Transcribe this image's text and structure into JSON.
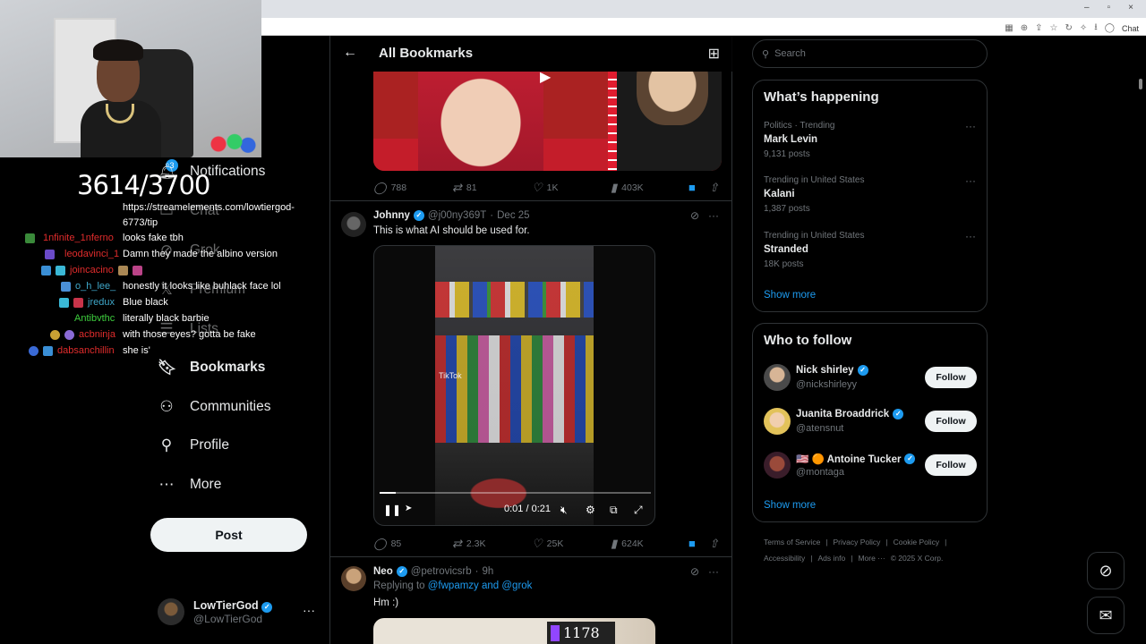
{
  "browser": {
    "minimize": "–",
    "restore": "▫",
    "close": "×",
    "chat_label": "Chat"
  },
  "nav": {
    "notifications": {
      "label": "Notifications",
      "badge": "3"
    },
    "chat": "Chat",
    "grok": "Grok",
    "premium": "Premium",
    "lists": "Lists",
    "bookmarks": "Bookmarks",
    "communities": "Communities",
    "profile": "Profile",
    "more": "More",
    "post_button": "Post",
    "account": {
      "name": "LowTierGod",
      "handle": "@LowTierGod"
    }
  },
  "overlay": {
    "counter": "3614/3700",
    "tip_link": "https://streamelements.com/lowtiergod-6773/tip",
    "chat": [
      {
        "user": "1nfinite_1nferno",
        "message": "looks fake tbh",
        "color": "#e02c2c"
      },
      {
        "user": "leodavinci_1",
        "message": "Damn they made the albino version",
        "color": "#e02c2c"
      },
      {
        "user": "joincacino",
        "message": "",
        "color": "#e02c2c"
      },
      {
        "user": "o_h_lee_",
        "message": "honestly it looks like buhlack face lol",
        "color": "#3fa7c9"
      },
      {
        "user": "jredux",
        "message": "Blue black",
        "color": "#3fa7c9"
      },
      {
        "user": "Antibvthc",
        "message": "literally black barbie",
        "color": "#3ecf3e"
      },
      {
        "user": "acbninja",
        "message": "with those eyes? gotta be fake",
        "color": "#e02c2c"
      },
      {
        "user": "dabsanchillin",
        "message": "she is'",
        "color": "#e02c2c"
      }
    ]
  },
  "header": {
    "title": "All Bookmarks"
  },
  "tweet1": {
    "replies": "788",
    "reposts": "81",
    "likes": "1K",
    "views": "403K"
  },
  "tweet2": {
    "name": "Johnny",
    "handle": "@j00ny369T",
    "date": "Dec 25",
    "text": "This is what AI should be used for.",
    "video_time": "0:01 / 0:21",
    "watermark": "TikTok",
    "replies": "85",
    "reposts": "2.3K",
    "likes": "25K",
    "views": "624K"
  },
  "tweet3": {
    "name": "Neo",
    "handle": "@petrovicsrb",
    "date": "9h",
    "replying_prefix": "Replying to",
    "replying_users": "@fwpamzy and @grok",
    "text": "Hm :)",
    "media_tag": "1178"
  },
  "search": {
    "placeholder": "Search"
  },
  "trends": {
    "title": "What’s happening",
    "items": [
      {
        "category": "Politics · Trending",
        "name": "Mark Levin",
        "count": "9,131 posts"
      },
      {
        "category": "Trending in United States",
        "name": "Kalani",
        "count": "1,387 posts"
      },
      {
        "category": "Trending in United States",
        "name": "Stranded",
        "count": "18K posts"
      }
    ],
    "show_more": "Show more"
  },
  "who_to_follow": {
    "title": "Who to follow",
    "users": [
      {
        "name": "Nick shirley",
        "handle": "@nickshirleyy",
        "button": "Follow"
      },
      {
        "name": "Juanita Broaddrick",
        "handle": "@atensnut",
        "button": "Follow"
      },
      {
        "name": "🇺🇸 🟠 Antoine Tucker",
        "handle": "@montaga",
        "button": "Follow"
      }
    ],
    "show_more": "Show more"
  },
  "footer": {
    "line1": [
      "Terms of Service",
      "Privacy Policy",
      "Cookie Policy"
    ],
    "line2": [
      "Accessibility",
      "Ads info",
      "More ···",
      "© 2025 X Corp."
    ]
  },
  "colors": {
    "accent": "#1d9bf0",
    "bg": "#000000",
    "border": "#2f3336",
    "muted": "#71767b"
  }
}
